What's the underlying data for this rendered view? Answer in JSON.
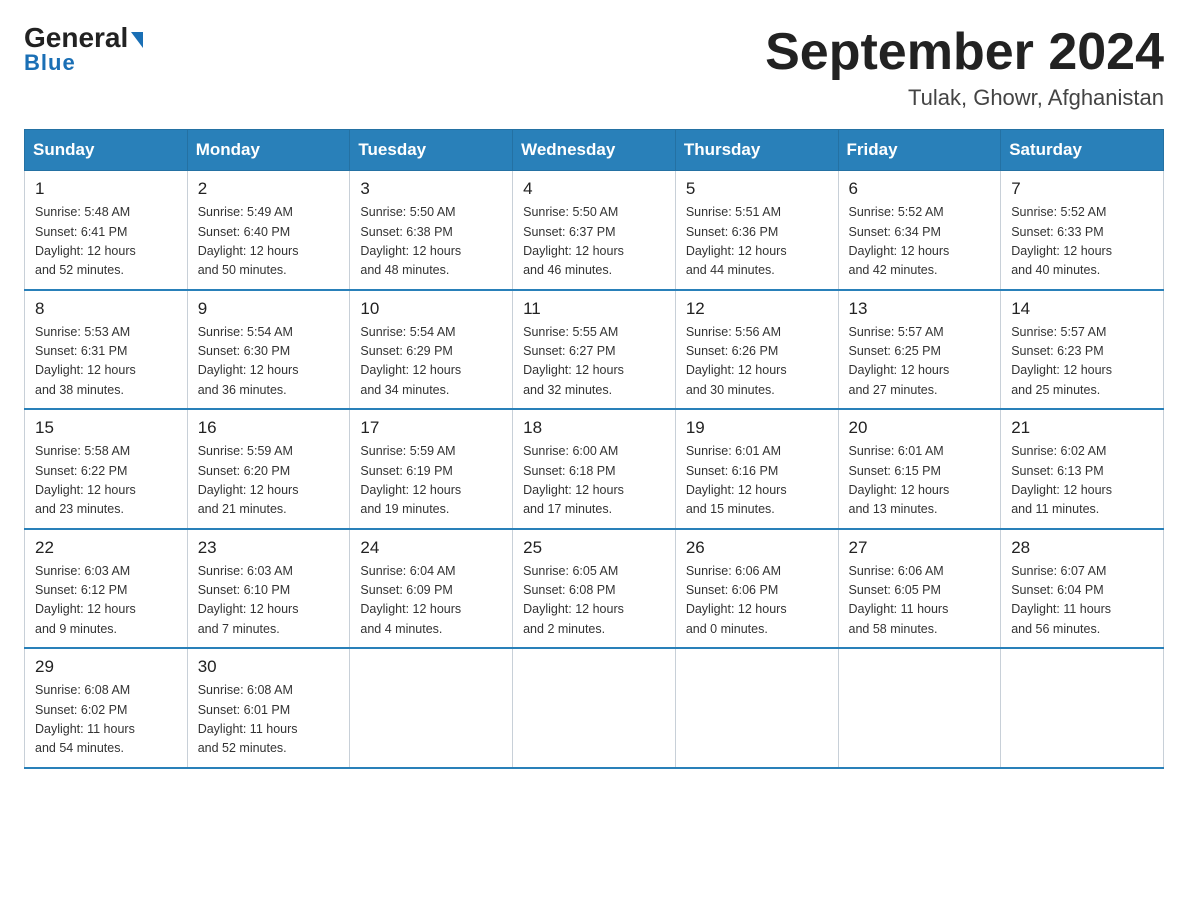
{
  "header": {
    "logo_general": "General",
    "logo_blue": "Blue",
    "title": "September 2024",
    "location": "Tulak, Ghowr, Afghanistan"
  },
  "weekdays": [
    "Sunday",
    "Monday",
    "Tuesday",
    "Wednesday",
    "Thursday",
    "Friday",
    "Saturday"
  ],
  "weeks": [
    [
      {
        "day": "1",
        "sunrise": "5:48 AM",
        "sunset": "6:41 PM",
        "daylight": "12 hours and 52 minutes."
      },
      {
        "day": "2",
        "sunrise": "5:49 AM",
        "sunset": "6:40 PM",
        "daylight": "12 hours and 50 minutes."
      },
      {
        "day": "3",
        "sunrise": "5:50 AM",
        "sunset": "6:38 PM",
        "daylight": "12 hours and 48 minutes."
      },
      {
        "day": "4",
        "sunrise": "5:50 AM",
        "sunset": "6:37 PM",
        "daylight": "12 hours and 46 minutes."
      },
      {
        "day": "5",
        "sunrise": "5:51 AM",
        "sunset": "6:36 PM",
        "daylight": "12 hours and 44 minutes."
      },
      {
        "day": "6",
        "sunrise": "5:52 AM",
        "sunset": "6:34 PM",
        "daylight": "12 hours and 42 minutes."
      },
      {
        "day": "7",
        "sunrise": "5:52 AM",
        "sunset": "6:33 PM",
        "daylight": "12 hours and 40 minutes."
      }
    ],
    [
      {
        "day": "8",
        "sunrise": "5:53 AM",
        "sunset": "6:31 PM",
        "daylight": "12 hours and 38 minutes."
      },
      {
        "day": "9",
        "sunrise": "5:54 AM",
        "sunset": "6:30 PM",
        "daylight": "12 hours and 36 minutes."
      },
      {
        "day": "10",
        "sunrise": "5:54 AM",
        "sunset": "6:29 PM",
        "daylight": "12 hours and 34 minutes."
      },
      {
        "day": "11",
        "sunrise": "5:55 AM",
        "sunset": "6:27 PM",
        "daylight": "12 hours and 32 minutes."
      },
      {
        "day": "12",
        "sunrise": "5:56 AM",
        "sunset": "6:26 PM",
        "daylight": "12 hours and 30 minutes."
      },
      {
        "day": "13",
        "sunrise": "5:57 AM",
        "sunset": "6:25 PM",
        "daylight": "12 hours and 27 minutes."
      },
      {
        "day": "14",
        "sunrise": "5:57 AM",
        "sunset": "6:23 PM",
        "daylight": "12 hours and 25 minutes."
      }
    ],
    [
      {
        "day": "15",
        "sunrise": "5:58 AM",
        "sunset": "6:22 PM",
        "daylight": "12 hours and 23 minutes."
      },
      {
        "day": "16",
        "sunrise": "5:59 AM",
        "sunset": "6:20 PM",
        "daylight": "12 hours and 21 minutes."
      },
      {
        "day": "17",
        "sunrise": "5:59 AM",
        "sunset": "6:19 PM",
        "daylight": "12 hours and 19 minutes."
      },
      {
        "day": "18",
        "sunrise": "6:00 AM",
        "sunset": "6:18 PM",
        "daylight": "12 hours and 17 minutes."
      },
      {
        "day": "19",
        "sunrise": "6:01 AM",
        "sunset": "6:16 PM",
        "daylight": "12 hours and 15 minutes."
      },
      {
        "day": "20",
        "sunrise": "6:01 AM",
        "sunset": "6:15 PM",
        "daylight": "12 hours and 13 minutes."
      },
      {
        "day": "21",
        "sunrise": "6:02 AM",
        "sunset": "6:13 PM",
        "daylight": "12 hours and 11 minutes."
      }
    ],
    [
      {
        "day": "22",
        "sunrise": "6:03 AM",
        "sunset": "6:12 PM",
        "daylight": "12 hours and 9 minutes."
      },
      {
        "day": "23",
        "sunrise": "6:03 AM",
        "sunset": "6:10 PM",
        "daylight": "12 hours and 7 minutes."
      },
      {
        "day": "24",
        "sunrise": "6:04 AM",
        "sunset": "6:09 PM",
        "daylight": "12 hours and 4 minutes."
      },
      {
        "day": "25",
        "sunrise": "6:05 AM",
        "sunset": "6:08 PM",
        "daylight": "12 hours and 2 minutes."
      },
      {
        "day": "26",
        "sunrise": "6:06 AM",
        "sunset": "6:06 PM",
        "daylight": "12 hours and 0 minutes."
      },
      {
        "day": "27",
        "sunrise": "6:06 AM",
        "sunset": "6:05 PM",
        "daylight": "11 hours and 58 minutes."
      },
      {
        "day": "28",
        "sunrise": "6:07 AM",
        "sunset": "6:04 PM",
        "daylight": "11 hours and 56 minutes."
      }
    ],
    [
      {
        "day": "29",
        "sunrise": "6:08 AM",
        "sunset": "6:02 PM",
        "daylight": "11 hours and 54 minutes."
      },
      {
        "day": "30",
        "sunrise": "6:08 AM",
        "sunset": "6:01 PM",
        "daylight": "11 hours and 52 minutes."
      },
      null,
      null,
      null,
      null,
      null
    ]
  ],
  "labels": {
    "sunrise_prefix": "Sunrise: ",
    "sunset_prefix": "Sunset: ",
    "daylight_prefix": "Daylight: "
  }
}
